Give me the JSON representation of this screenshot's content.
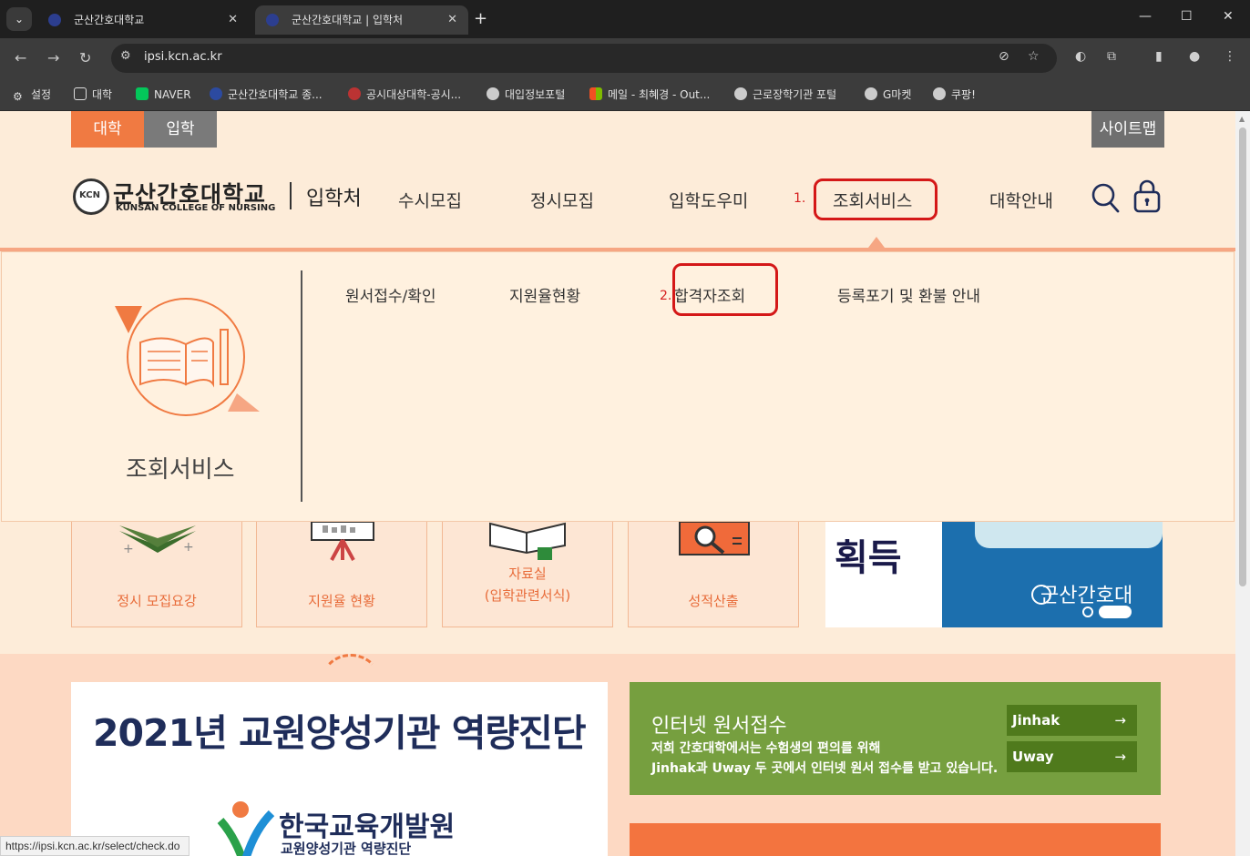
{
  "browser": {
    "tabs": [
      {
        "title": "군산간호대학교",
        "active": false
      },
      {
        "title": "군산간호대학교 | 입학처",
        "active": true
      }
    ],
    "url": "ipsi.kcn.ac.kr",
    "bookmarks": [
      {
        "label": "설정",
        "icon": "gear-icon"
      },
      {
        "label": "대학",
        "icon": "folder-icon"
      },
      {
        "label": "NAVER",
        "icon": "naver-icon"
      },
      {
        "label": "군산간호대학교 종...",
        "icon": "kcn-icon"
      },
      {
        "label": "공시대상대학-공시...",
        "icon": "globe-icon"
      },
      {
        "label": "대입정보포털",
        "icon": "globe-icon"
      },
      {
        "label": "메일 - 최혜경 - Out...",
        "icon": "microsoft-icon"
      },
      {
        "label": "근로장학기관 포털",
        "icon": "globe-icon"
      },
      {
        "label": "G마켓",
        "icon": "globe-icon"
      },
      {
        "label": "쿠팡!",
        "icon": "globe-icon"
      }
    ],
    "status_url": "https://ipsi.kcn.ac.kr/select/check.do"
  },
  "site": {
    "top_tabs": [
      "대학",
      "입학"
    ],
    "sitemap_label": "사이트맵",
    "logo_kr": "군산간호대학교",
    "logo_en": "KUNSAN COLLEGE OF NURSING",
    "logo_sub": "입학처",
    "nav": [
      "수시모집",
      "정시모집",
      "입학도우미",
      "조회서비스",
      "대학안내"
    ],
    "step1": "1.",
    "step2": "2.",
    "dropdown": {
      "title": "조회서비스",
      "items": [
        "원서접수/확인",
        "지원율현황",
        "합격자조회",
        "등록포기 및 환불 안내"
      ]
    },
    "quick": [
      {
        "label": "정시 모집요강"
      },
      {
        "label": "지원율 현황"
      },
      {
        "label_line1": "자료실",
        "label_line2": "(입학관련서식)"
      },
      {
        "label": "성적산출"
      }
    ],
    "banner_right": {
      "big": "획득",
      "sign": "군산간호대"
    },
    "banner_left": {
      "title": "2021년 교원양성기관 역량진단",
      "org": "한국교육개발원",
      "org_sub": "교원양성기관 역량진단"
    },
    "apply": {
      "heading": "인터넷 원서접수",
      "desc1": "저희 간호대학에서는 수험생의 편의를 위해",
      "desc2": "Jinhak과 Uway 두 곳에서 인터넷 원서 접수를 받고 있습니다.",
      "buttons": [
        "Jinhak",
        "Uway"
      ]
    }
  },
  "colors": {
    "accent": "#f07a42",
    "page_bg": "#fdecd9",
    "highlight": "#d41818",
    "green": "#769f3f"
  }
}
